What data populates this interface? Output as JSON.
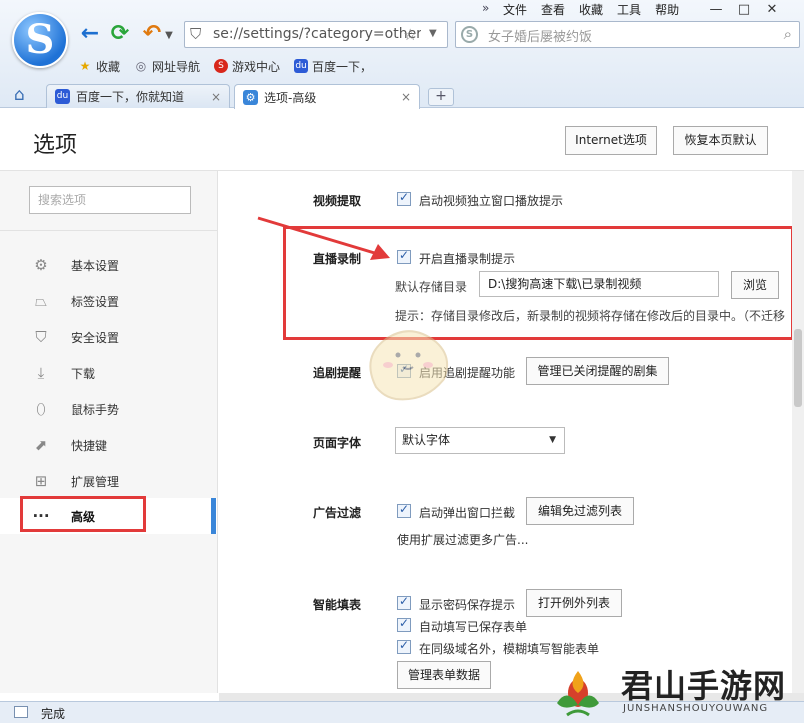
{
  "menu": {
    "chevrons": "»",
    "items": [
      "文件",
      "查看",
      "收藏",
      "工具",
      "帮助"
    ]
  },
  "window_controls": {
    "minimize": "—",
    "maximize": "□",
    "close": "✕"
  },
  "address": {
    "url": "se://settings/?category=other"
  },
  "search": {
    "placeholder": "女子婚后屡被约饭"
  },
  "bookmarks": [
    "收藏",
    "网址导航",
    "游戏中心",
    "百度一下，"
  ],
  "tabs": [
    {
      "label": "百度一下，你就知道",
      "close": "×"
    },
    {
      "label": "选项-高级",
      "close": "×"
    }
  ],
  "new_tab": "+",
  "header": {
    "title": "选项",
    "internet_options": "Internet选项",
    "restore_defaults": "恢复本页默认"
  },
  "sidebar": {
    "search_placeholder": "搜索选项",
    "items": [
      {
        "label": "基本设置",
        "icon": "gear-icon"
      },
      {
        "label": "标签设置",
        "icon": "tab-icon"
      },
      {
        "label": "安全设置",
        "icon": "shield-icon"
      },
      {
        "label": "下载",
        "icon": "download-icon"
      },
      {
        "label": "鼠标手势",
        "icon": "mouse-icon"
      },
      {
        "label": "快捷键",
        "icon": "shortcut-icon"
      },
      {
        "label": "扩展管理",
        "icon": "extensions-icon"
      },
      {
        "label": "高级",
        "icon": "more-icon",
        "active": true
      }
    ]
  },
  "sections": {
    "video": {
      "label": "视频提取",
      "option": "启动视频独立窗口播放提示",
      "checked": true
    },
    "live": {
      "label": "直播录制",
      "option": "开启直播录制提示",
      "checked": true,
      "dir_label": "默认存储目录",
      "dir_value": "D:\\搜狗高速下载\\已录制视频",
      "browse": "浏览",
      "hint": "提示：存储目录修改后，新录制的视频将存储在修改后的目录中。（不迁移"
    },
    "drama": {
      "label": "追剧提醒",
      "option": "启用追剧提醒功能",
      "checked": true,
      "button": "管理已关闭提醒的剧集"
    },
    "font": {
      "label": "页面字体",
      "selected": "默认字体"
    },
    "adblock": {
      "label": "广告过滤",
      "option": "启动弹出窗口拦截",
      "checked": true,
      "button": "编辑免过滤列表",
      "note": "使用扩展过滤更多广告..."
    },
    "autofill": {
      "label": "智能填表",
      "option1": "显示密码保存提示",
      "button1": "打开例外列表",
      "option2": "自动填写已保存表单",
      "option3": "在同级域名外，模糊填写智能表单",
      "button2": "管理表单数据"
    }
  },
  "status": {
    "text": "完成"
  },
  "watermark": {
    "title": "君山手游网",
    "sub": "JUNSHANSHOUYOUWANG"
  },
  "colors": {
    "accent": "#3a86d9",
    "highlight": "#e23a3a"
  }
}
